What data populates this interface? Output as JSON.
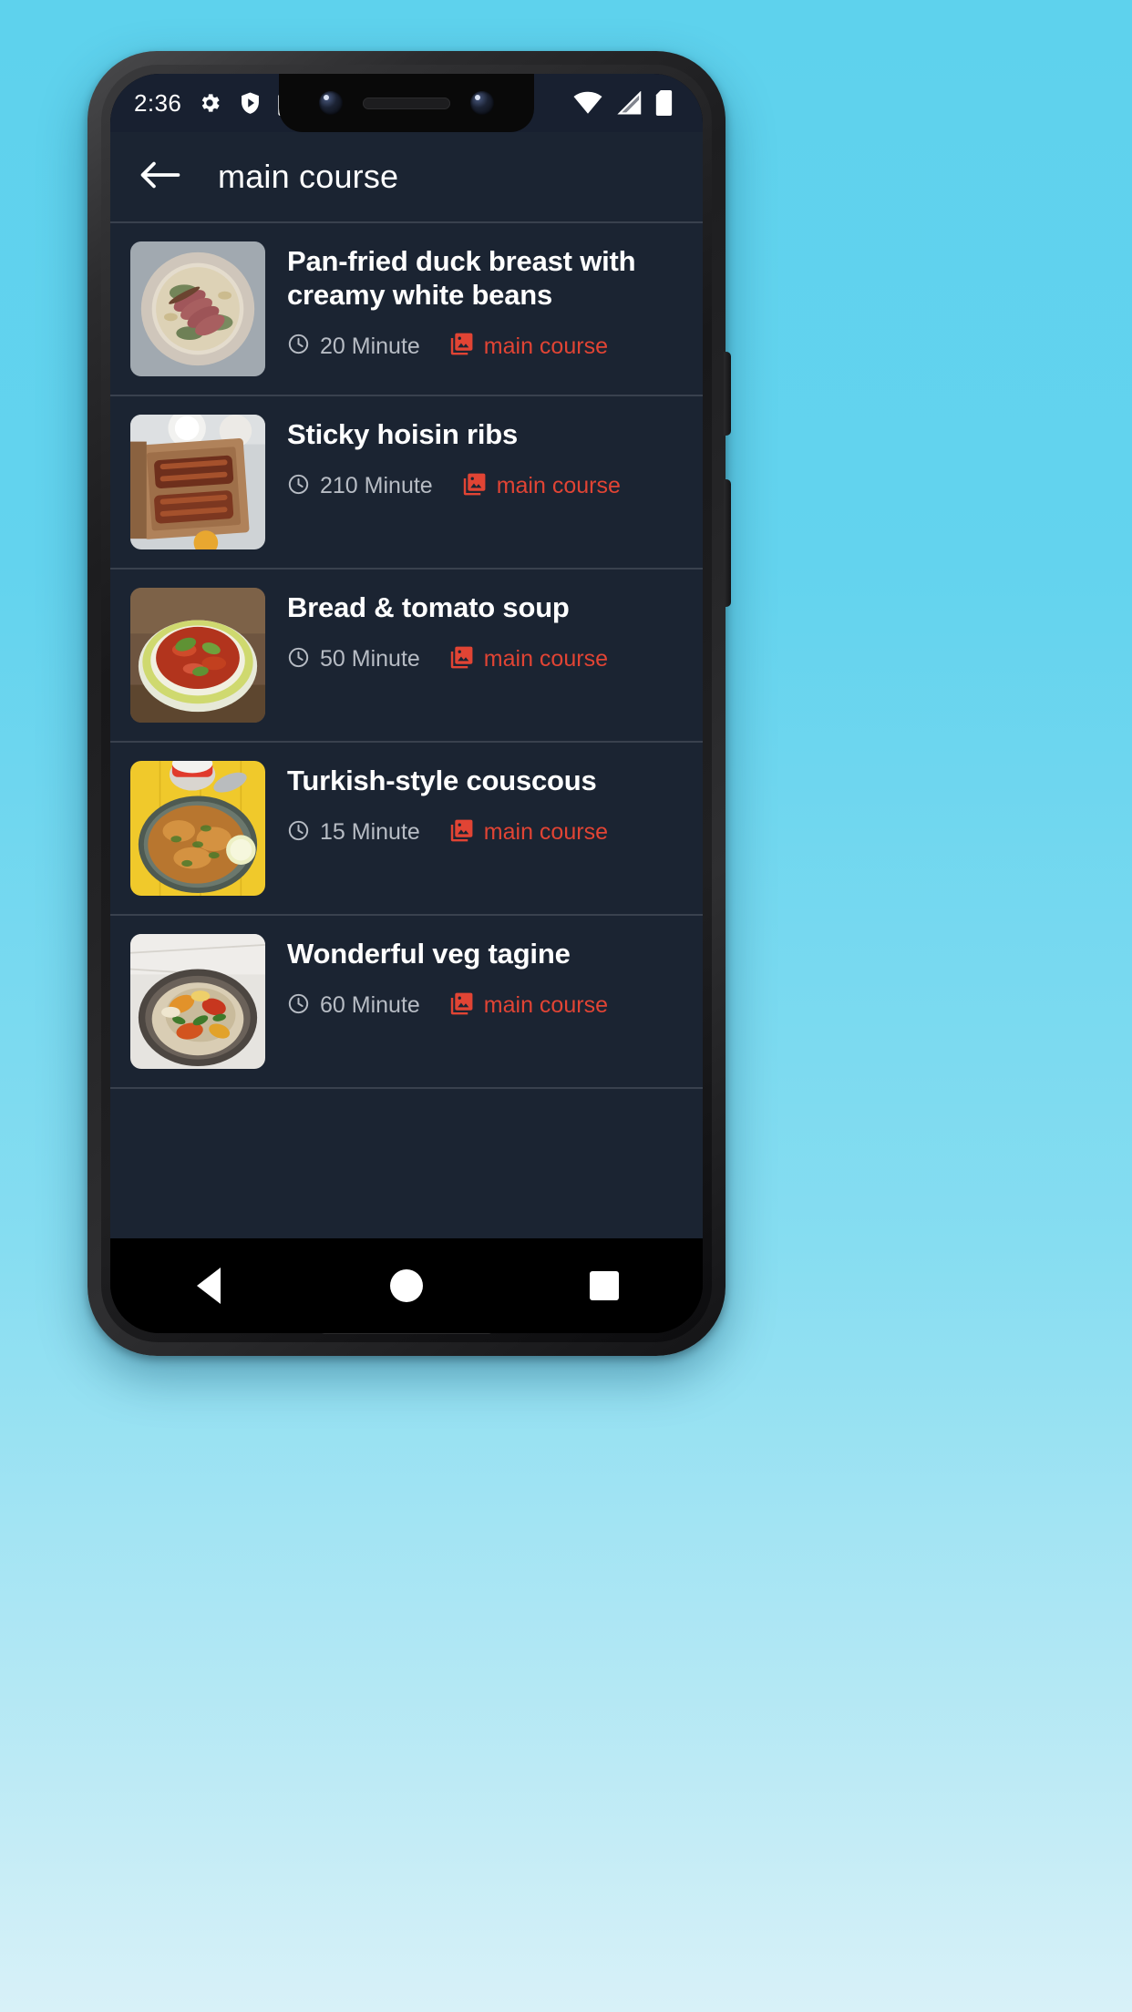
{
  "status_bar": {
    "time": "2:36",
    "left_icons": [
      "settings-gear-icon",
      "play-protect-shield-icon",
      "sd-card-icon"
    ],
    "right_icons": [
      "wifi-icon",
      "cellular-signal-icon",
      "battery-icon"
    ]
  },
  "app_bar": {
    "back_icon": "arrow-back-icon",
    "title": "main course"
  },
  "list": {
    "items": [
      {
        "title": "Pan-fried duck breast with creamy white beans",
        "time": "20 Minute",
        "category": "main course",
        "time_icon": "clock-icon",
        "category_icon": "photo-library-icon",
        "thumb": "duck-breast-white-beans"
      },
      {
        "title": "Sticky hoisin ribs",
        "time": "210 Minute",
        "category": "main course",
        "time_icon": "clock-icon",
        "category_icon": "photo-library-icon",
        "thumb": "sticky-hoisin-ribs"
      },
      {
        "title": "Bread & tomato soup",
        "time": "50 Minute",
        "category": "main course",
        "time_icon": "clock-icon",
        "category_icon": "photo-library-icon",
        "thumb": "bread-tomato-soup"
      },
      {
        "title": "Turkish-style couscous",
        "time": "15 Minute",
        "category": "main course",
        "time_icon": "clock-icon",
        "category_icon": "photo-library-icon",
        "thumb": "turkish-style-couscous"
      },
      {
        "title": "Wonderful veg tagine",
        "time": "60 Minute",
        "category": "main course",
        "time_icon": "clock-icon",
        "category_icon": "photo-library-icon",
        "thumb": "wonderful-veg-tagine"
      }
    ]
  },
  "nav_bar": {
    "back": "nav-back-icon",
    "home": "nav-home-icon",
    "recents": "nav-recents-icon"
  },
  "colors": {
    "accent": "#E14434",
    "app_background": "#1B2432",
    "status_bar_background": "#182030",
    "divider": "#39414E",
    "title_text": "#FFFFFF",
    "meta_text": "#B7BCC4",
    "page_background_top": "#5ED2ED",
    "page_background_bottom": "#D8F1F8"
  }
}
